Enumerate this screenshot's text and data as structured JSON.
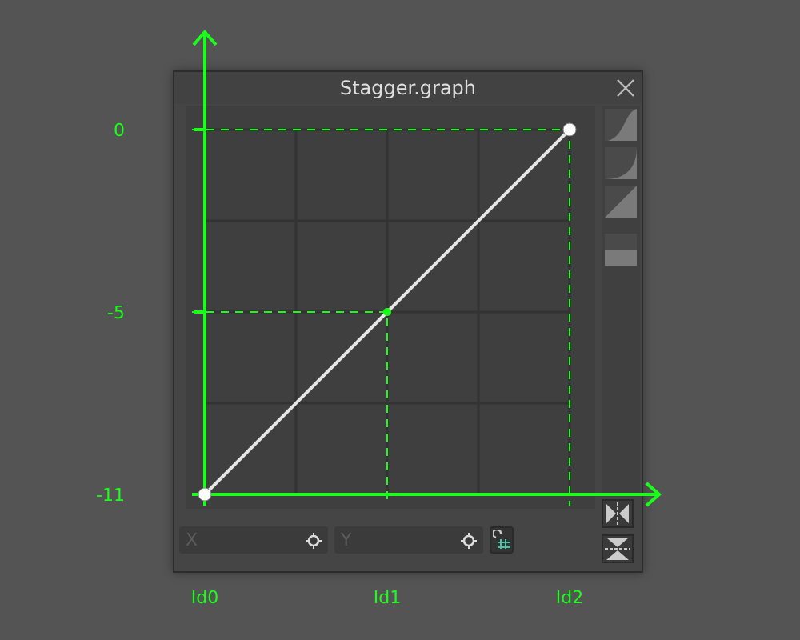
{
  "window": {
    "title": "Stagger.graph"
  },
  "graph": {
    "y_labels": [
      "0",
      "-5",
      "-11"
    ],
    "x_labels": [
      "Id0",
      "Id1",
      "Id2"
    ]
  },
  "fields": [
    {
      "placeholder": "X"
    },
    {
      "placeholder": "Y"
    }
  ]
}
